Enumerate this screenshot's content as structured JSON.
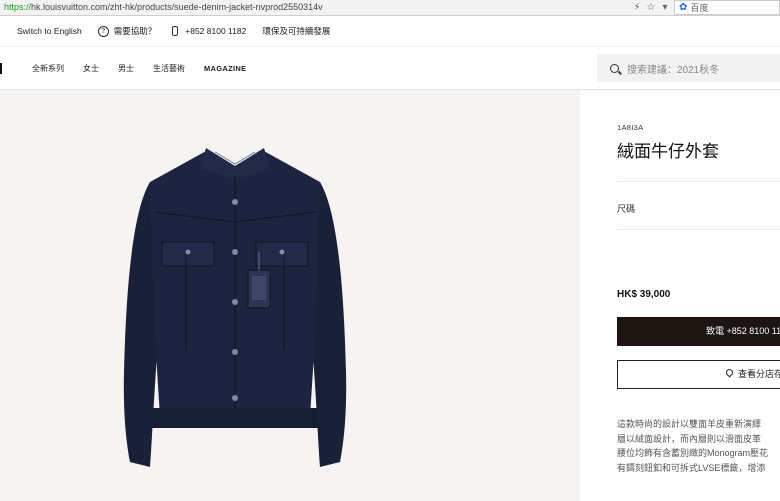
{
  "browser": {
    "url_scheme": "https://",
    "url_rest": "hk.louisvuitton.com/zht-hk/products/suede-denim-jacket-nvprod2550314v",
    "search_placeholder": "百度"
  },
  "utility_bar": {
    "language": "Switch to English",
    "help": "需要協助？",
    "phone": "+852 8100 1182",
    "sustainability": "環保及可持續發展"
  },
  "nav": {
    "items": [
      "全新系列",
      "女士",
      "男士",
      "生活藝術",
      "MAGAZINE"
    ],
    "search_placeholder": "搜索建議：2021秋冬"
  },
  "product": {
    "sku": "1A8I3A",
    "title": "絨面牛仔外套",
    "size_label": "尺碼",
    "price": "HK$ 39,000",
    "call_button": "致電 +852 8100 11",
    "store_button": "查看分店存",
    "description_lines": [
      "這款時尚的設計以雙面羊皮重新演繹",
      "層以絨面設計，而內層則以滑面皮革",
      "腰位均飾有含蓄別緻的Monogram壓花",
      "有鑄刻鈕釦和可拆式LVSE標籤，增添"
    ]
  },
  "colors": {
    "accent": "#1c1512",
    "image_bg": "#f5f4f2",
    "jacket": "#1d2440"
  }
}
